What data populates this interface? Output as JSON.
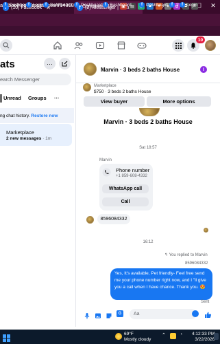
{
  "browser": {
    "tabs": [
      {
        "label": "(10) Facebook",
        "active": false
      },
      {
        "label": "(2) Messenger | Facebook",
        "active": true
      }
    ],
    "address": "acebook.com/messages/t/14018",
    "container_label": "Container #19",
    "bookmarks": [
      "Dashboard",
      "Login",
      "Dashboard",
      "Dashboard",
      "Dashboard",
      "Dashboard",
      "?",
      "Login"
    ]
  },
  "fb_header": {
    "notification_count": "10"
  },
  "sidebar": {
    "title": "ats",
    "search_placeholder": "earch Messenger",
    "tabs": [
      "Unread",
      "Groups"
    ],
    "more_tabs": "···",
    "history_notice": "ng chat history.",
    "history_link": "Restore now",
    "conversation": {
      "name": "Marketplace",
      "subtitle": "2 new messages",
      "time": "1m"
    }
  },
  "chat": {
    "title": "Marvin · 3 beds 2 baths House",
    "marketplace_label": "Marketplace",
    "listing": "$750 · 3 beds 2 baths House",
    "view_buyer": "View buyer",
    "more_options": "More options",
    "profile_name": "Marvin · 3 beds 2 baths House",
    "timestamp1": "Sat 18:57",
    "sender": "Marvin",
    "phone_label": "Phone number",
    "phone_number": "+1 859-608-4332",
    "whatsapp_btn": "WhatsApp call",
    "call_btn": "Call",
    "received_msg": "8596084332",
    "timestamp2": "16:12",
    "replied_to": "You replied to Marvin",
    "quoted": "8596084332",
    "sent_msg": "Yes, It's available, Pet friendly- Feel free send me your phone number right now, and I \"ll give you a call when I have chance. Thank you. 😍",
    "sent_status": "Sent",
    "input_placeholder": "Aa"
  },
  "taskbar": {
    "temperature": "69°F",
    "weather_desc": "Mostly cloudy",
    "time": "4:12:33 PM",
    "date": "3/22/2026"
  },
  "colors": {
    "brand": "#1877f2",
    "tab_bar": "#3a0b2b",
    "info_icon": "#8a2be2",
    "notification": "#e41e3f"
  }
}
